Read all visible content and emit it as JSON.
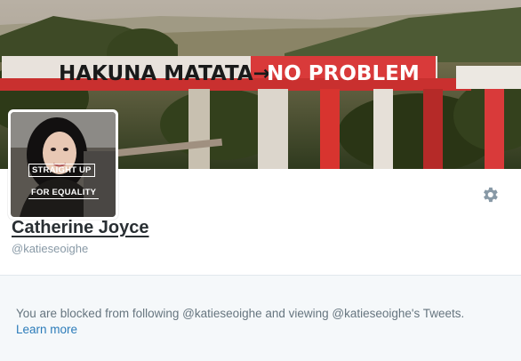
{
  "banner": {
    "sign_text_left": "HAKUNA MATATA→",
    "sign_text_right": "NO PROBLEM"
  },
  "avatar": {
    "line1": "STRAIGHT UP",
    "line2": "FOR EQUALITY"
  },
  "profile": {
    "name": "Catherine Joyce",
    "handle": "@katieseoighe"
  },
  "settings": {
    "icon": "gear-icon"
  },
  "blocked_notice": {
    "message": "You are blocked from following @katieseoighe and viewing @katieseoighe's Tweets.",
    "learn_more": "Learn more"
  },
  "colors": {
    "link": "#2b7bb9",
    "notice_bg": "#f5f8fa",
    "name_text": "#292f33",
    "muted_text": "#8899a6"
  }
}
